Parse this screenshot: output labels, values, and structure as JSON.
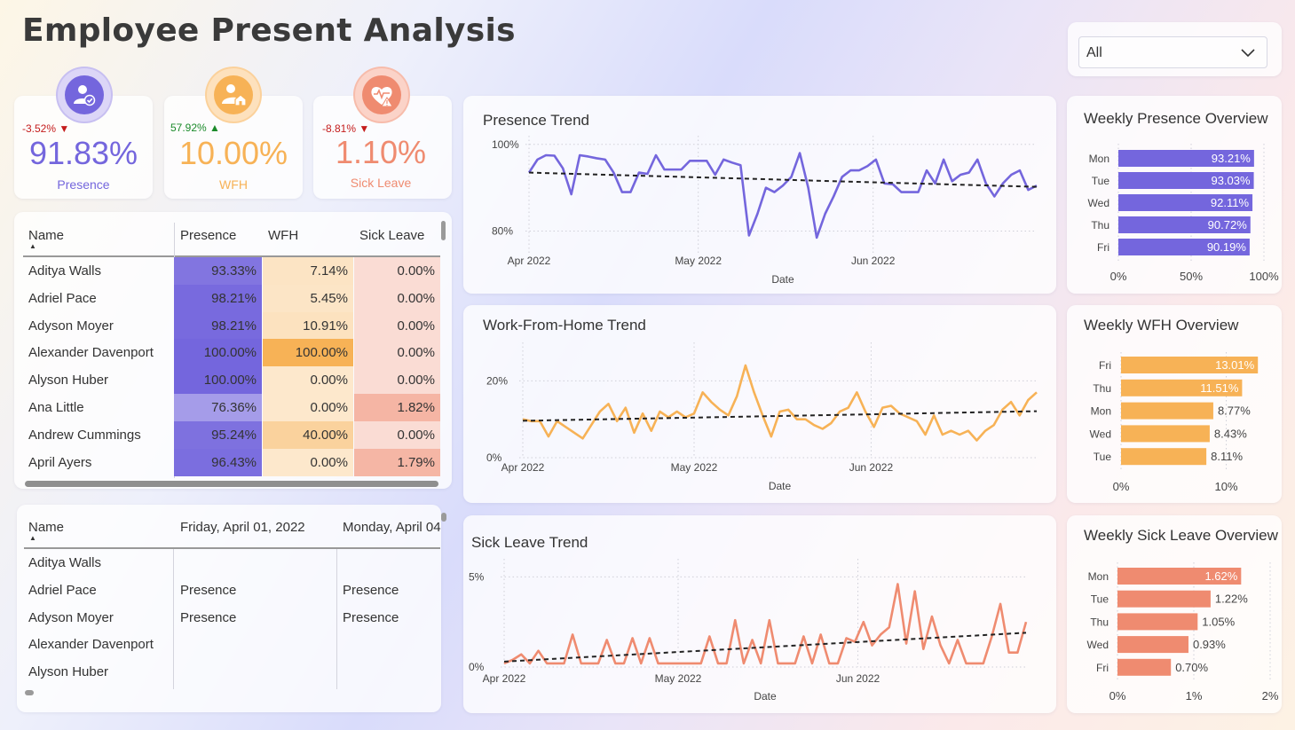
{
  "header": {
    "title": "Employee Present Analysis"
  },
  "filter": {
    "value": "All"
  },
  "kpis": [
    {
      "delta": "-3.52%",
      "value": "91.83%",
      "label": "Presence",
      "icon": "person-check-icon"
    },
    {
      "delta": "57.92%",
      "value": "10.00%",
      "label": "WFH",
      "icon": "person-home-icon"
    },
    {
      "delta": "-8.81%",
      "value": "1.10%",
      "label": "Sick Leave",
      "icon": "heart-alert-icon"
    }
  ],
  "colors": {
    "presence": "#7466dd",
    "wfh": "#f7b256",
    "sick": "#ef8b70",
    "delta_down": "#c41c1c",
    "delta_up": "#1b8a2a"
  },
  "summary_table": {
    "headers": [
      "Name",
      "Presence",
      "WFH",
      "Sick Leave"
    ],
    "rows": [
      {
        "name": "Aditya Walls",
        "presence": "93.33%",
        "wfh": "7.14%",
        "sick": "0.00%"
      },
      {
        "name": "Adriel Pace",
        "presence": "98.21%",
        "wfh": "5.45%",
        "sick": "0.00%"
      },
      {
        "name": "Adyson Moyer",
        "presence": "98.21%",
        "wfh": "10.91%",
        "sick": "0.00%"
      },
      {
        "name": "Alexander Davenport",
        "presence": "100.00%",
        "wfh": "100.00%",
        "sick": "0.00%"
      },
      {
        "name": "Alyson Huber",
        "presence": "100.00%",
        "wfh": "0.00%",
        "sick": "0.00%"
      },
      {
        "name": "Ana Little",
        "presence": "76.36%",
        "wfh": "0.00%",
        "sick": "1.82%"
      },
      {
        "name": "Andrew Cummings",
        "presence": "95.24%",
        "wfh": "40.00%",
        "sick": "0.00%"
      },
      {
        "name": "April Ayers",
        "presence": "96.43%",
        "wfh": "0.00%",
        "sick": "1.79%"
      }
    ]
  },
  "daily_table": {
    "headers": [
      "Name",
      "Friday, April 01, 2022",
      "Monday, April 04"
    ],
    "rows": [
      {
        "name": "Aditya Walls",
        "d1": "",
        "d2": ""
      },
      {
        "name": "Adriel Pace",
        "d1": "Presence",
        "d2": "Presence"
      },
      {
        "name": "Adyson Moyer",
        "d1": "Presence",
        "d2": "Presence"
      },
      {
        "name": "Alexander Davenport",
        "d1": "",
        "d2": ""
      },
      {
        "name": "Alyson Huber",
        "d1": "",
        "d2": ""
      }
    ]
  },
  "chart_data": [
    {
      "type": "line",
      "title": "Presence Trend",
      "xlabel": "Date",
      "ylabel": "",
      "x_ticks": [
        "Apr 2022",
        "May 2022",
        "Jun 2022"
      ],
      "y_ticks": [
        "80%",
        "100%"
      ],
      "ylim": [
        75,
        102
      ],
      "x_range": [
        "2022-04-01",
        "2022-06-30"
      ],
      "series": [
        {
          "values": [
            93.5,
            96.5,
            97.5,
            97.4,
            94.5,
            88.5,
            97.5,
            97.2,
            96.8,
            96.5,
            93.5,
            89,
            89,
            93.5,
            93.2,
            97.5,
            94.2,
            94.2,
            94.2,
            96.2,
            96.2,
            96.2,
            93,
            96.5,
            95.8,
            95.2,
            79,
            84,
            90,
            89,
            90.5,
            92.5,
            98,
            90,
            78.5,
            84,
            88,
            92.5,
            94,
            94,
            95,
            96.5,
            91,
            90.8,
            89,
            89,
            89,
            94,
            91,
            96.5,
            91.5,
            93,
            93.5,
            96.5,
            91,
            88,
            91,
            93,
            94,
            89.5,
            90.5
          ]
        }
      ],
      "trend": {
        "start": 93.5,
        "end": 90.2
      },
      "grid": true
    },
    {
      "type": "line",
      "title": "Work-From-Home Trend",
      "xlabel": "Date",
      "ylabel": "",
      "x_ticks": [
        "Apr 2022",
        "May 2022",
        "Jun 2022"
      ],
      "y_ticks": [
        "0%",
        "20%"
      ],
      "ylim": [
        0,
        30
      ],
      "x_range": [
        "2022-04-01",
        "2022-06-30"
      ],
      "series": [
        {
          "values": [
            10,
            9.5,
            9.5,
            5.5,
            9.5,
            8,
            6.5,
            5,
            8.5,
            12,
            14,
            9.5,
            13,
            6.5,
            11.5,
            7,
            12,
            10.5,
            12,
            10.5,
            11.5,
            17,
            14.5,
            12.5,
            11,
            16,
            24,
            17,
            11,
            5.5,
            12,
            12.5,
            10,
            10,
            8.5,
            7.5,
            9,
            12,
            13,
            17,
            12,
            8,
            13,
            13.5,
            11.5,
            10.5,
            9.5,
            6,
            11,
            6,
            7,
            6,
            7,
            4.5,
            7,
            8.5,
            12.5,
            14.5,
            11,
            15,
            17
          ]
        }
      ],
      "trend": {
        "start": 9.6,
        "end": 12.1
      },
      "grid": true
    },
    {
      "type": "line",
      "title": "Sick Leave Trend",
      "xlabel": "Date",
      "ylabel": "",
      "x_ticks": [
        "Apr 2022",
        "May 2022",
        "Jun 2022"
      ],
      "y_ticks": [
        "0%",
        "5%"
      ],
      "ylim": [
        0,
        6
      ],
      "x_range": [
        "2022-04-01",
        "2022-06-30"
      ],
      "series": [
        {
          "values": [
            0.2,
            0.4,
            0.7,
            0.2,
            0.9,
            0.2,
            0.2,
            0.2,
            1.8,
            0.2,
            0.2,
            0.2,
            1.5,
            0.2,
            0.2,
            1.6,
            0.2,
            1.6,
            0.2,
            0.2,
            0.2,
            0.2,
            0.2,
            0.2,
            1.7,
            0.2,
            0.2,
            2.6,
            0.2,
            1.5,
            0.2,
            2.6,
            0.2,
            0.2,
            0.2,
            1.7,
            0.2,
            1.8,
            0.2,
            0.2,
            1.6,
            1.4,
            2.5,
            1.2,
            1.8,
            2.2,
            4.6,
            1.3,
            4.2,
            1.0,
            2.8,
            1.2,
            0.2,
            1.5,
            0.2,
            0.2,
            0.2,
            1.7,
            3.5,
            0.8,
            0.8,
            2.5
          ]
        }
      ],
      "trend": {
        "start": 0.3,
        "end": 1.9
      },
      "grid": true
    },
    {
      "type": "bar",
      "title": "Weekly Presence Overview",
      "categories": [
        "Mon",
        "Tue",
        "Wed",
        "Thu",
        "Fri"
      ],
      "values": [
        93.21,
        93.03,
        92.11,
        90.72,
        90.19
      ],
      "labels": [
        "93.21%",
        "93.03%",
        "92.11%",
        "90.72%",
        "90.19%"
      ],
      "x_ticks": [
        "0%",
        "50%",
        "100%"
      ],
      "xlim": [
        0,
        100
      ]
    },
    {
      "type": "bar",
      "title": "Weekly WFH Overview",
      "categories": [
        "Fri",
        "Thu",
        "Mon",
        "Wed",
        "Tue"
      ],
      "values": [
        13.01,
        11.51,
        8.77,
        8.43,
        8.11
      ],
      "labels": [
        "13.01%",
        "11.51%",
        "8.77%",
        "8.43%",
        "8.11%"
      ],
      "x_ticks": [
        "0%",
        "10%"
      ],
      "xlim": [
        0,
        13.5
      ]
    },
    {
      "type": "bar",
      "title": "Weekly Sick Leave Overview",
      "categories": [
        "Mon",
        "Tue",
        "Thu",
        "Wed",
        "Fri"
      ],
      "values": [
        1.62,
        1.22,
        1.05,
        0.93,
        0.7
      ],
      "labels": [
        "1.62%",
        "1.22%",
        "1.05%",
        "0.93%",
        "0.70%"
      ],
      "x_ticks": [
        "0%",
        "1%",
        "2%"
      ],
      "xlim": [
        0,
        2
      ]
    }
  ]
}
